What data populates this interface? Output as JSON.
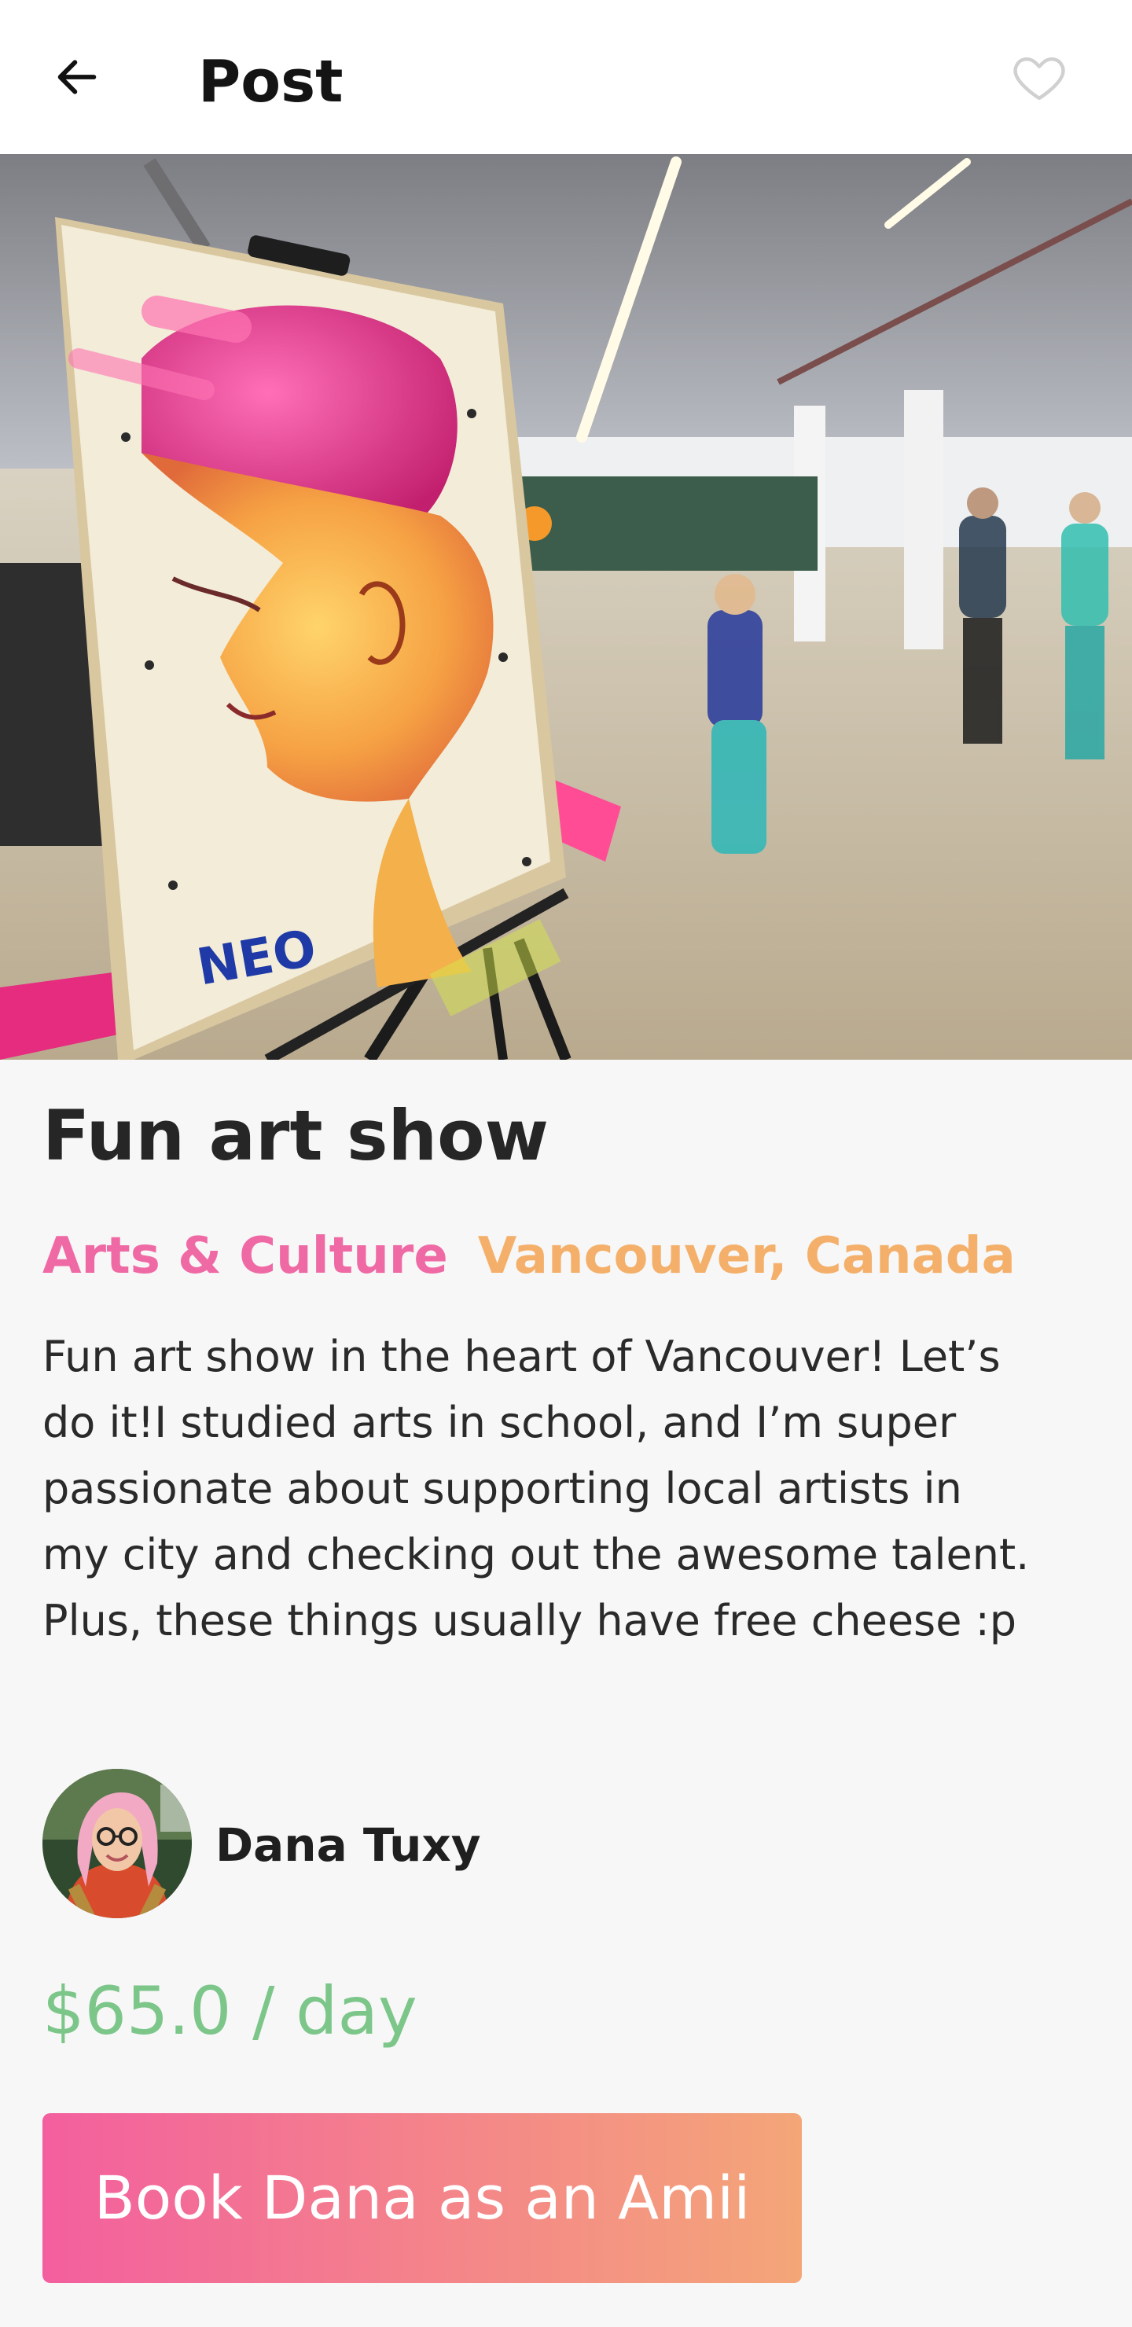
{
  "app_bar": {
    "title": "Post",
    "back_icon": "arrow-left-icon",
    "favorite_icon": "heart-outline-icon"
  },
  "post": {
    "title": "Fun art show",
    "category": "Arts & Culture",
    "location": "Vancouver, Canada",
    "description": "Fun art show in the heart of Vancouver! Let’s do it!I studied arts in school, and I’m super passionate about supporting local artists in my city and checking out the awesome talent. Plus, these things usually have free cheese :p",
    "image_text": "NEO"
  },
  "host": {
    "name": "Dana Tuxy"
  },
  "price": "$65.0 / day",
  "book_button": {
    "label": "Book Dana as an Amii"
  },
  "colors": {
    "category": "#ef6aa5",
    "location": "#f4b06b",
    "price": "#7cc68a",
    "button_gradient_start": "#f35f9e",
    "button_gradient_end": "#f4a678"
  }
}
